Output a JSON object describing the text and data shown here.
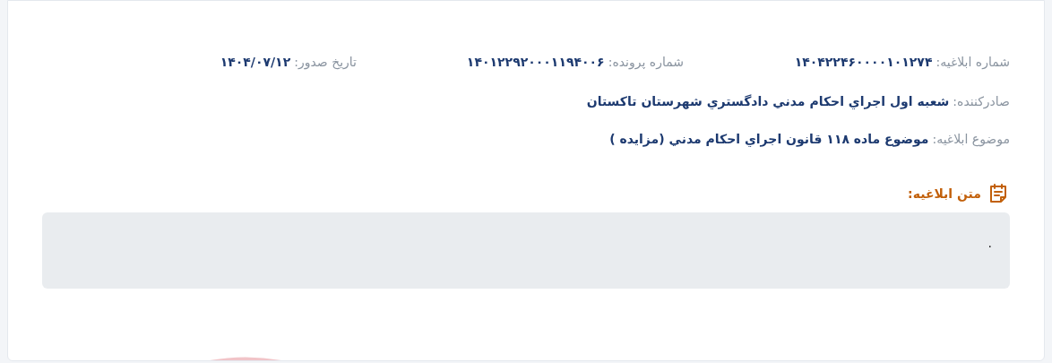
{
  "fields": [
    {
      "label": "شماره ابلاغیه:",
      "value": "۱۴۰۴۲۲۴۶۰۰۰۰۱۰۱۲۷۴"
    },
    {
      "label": "شماره پرونده:",
      "value": "۱۴۰۱۲۲۹۲۰۰۰۱۱۹۴۰۰۶"
    },
    {
      "label": "تاریخ صدور:",
      "value": "۱۴۰۴/۰۷/۱۲"
    }
  ],
  "issuer": {
    "label": "صادرکننده:",
    "value": "شعبه اول اجراي احكام مدني دادگستري شهرستان تاكستان"
  },
  "subject": {
    "label": "موضوع ابلاغیه:",
    "value": "موضوع ماده ۱۱۸ قانون اجراي احكام مدني (مزايده )"
  },
  "notice_text": {
    "heading": "متن ابلاغیه:",
    "body": "."
  }
}
